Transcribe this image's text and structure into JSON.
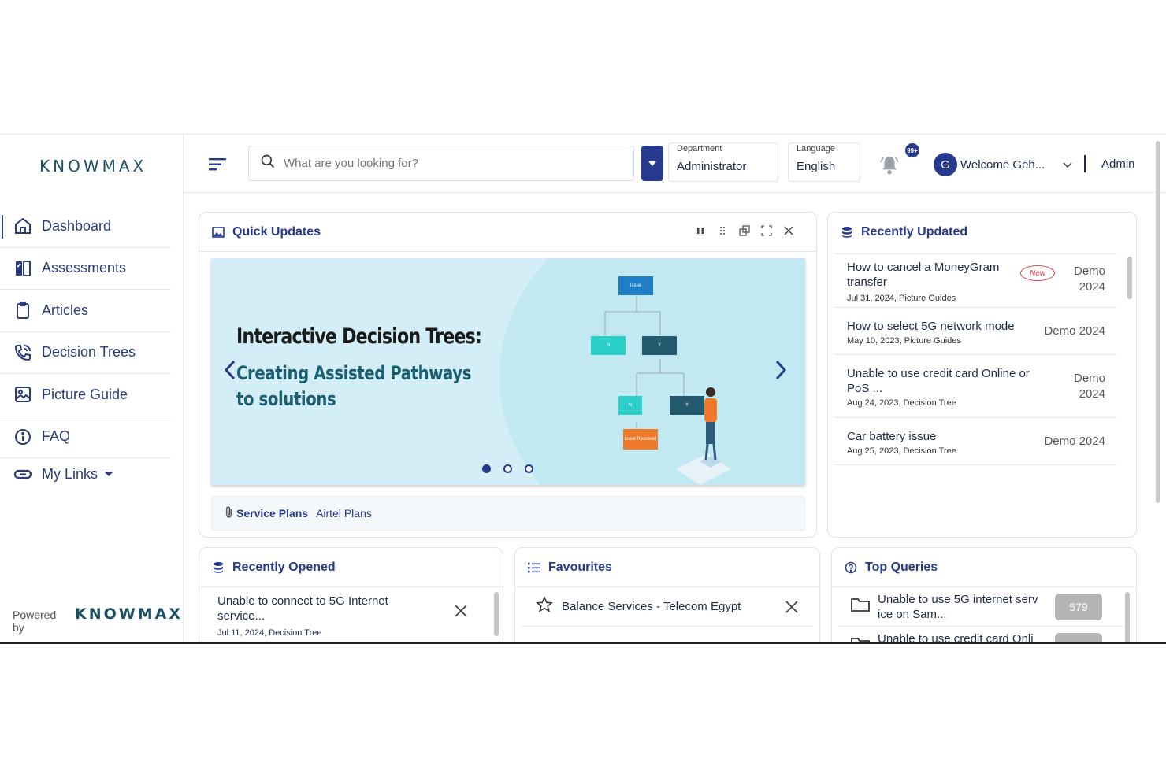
{
  "brand": {
    "logo": "KNOWMAX",
    "powered_by": "Powered by",
    "powered_logo": "KNOWMAX"
  },
  "sidebar": {
    "items": [
      {
        "label": "Dashboard",
        "icon": "home-icon",
        "active": true
      },
      {
        "label": "Assessments",
        "icon": "assessment-icon"
      },
      {
        "label": "Articles",
        "icon": "clipboard-icon"
      },
      {
        "label": "Decision Trees",
        "icon": "phone-icon"
      },
      {
        "label": "Picture Guide",
        "icon": "image-icon"
      },
      {
        "label": "FAQ",
        "icon": "info-icon"
      },
      {
        "label": "My Links",
        "icon": "link-icon"
      }
    ]
  },
  "header": {
    "search_placeholder": "What are you looking for?",
    "department": {
      "label": "Department",
      "value": "Administrator"
    },
    "language": {
      "label": "Language",
      "value": "English"
    },
    "notif_badge": "99+",
    "avatar_initial": "G",
    "welcome": "Welcome  Geh...",
    "role": "Admin"
  },
  "quick_updates": {
    "title": "Quick Updates",
    "banner_heading": "Interactive Decision Trees:",
    "banner_subheading": "Creating Assisted Pathways to solutions",
    "tree_labels": [
      "Issue",
      "N",
      "Y",
      "N",
      "Y",
      "Issue Resolved"
    ],
    "links_label": "Service Plans",
    "links_value": "Airtel Plans"
  },
  "recently_updated": {
    "title": "Recently Updated",
    "new_badge": "New",
    "items": [
      {
        "title": "How to cancel a MoneyGram transfer",
        "meta": "Jul 31, 2024, Picture Guides",
        "right1": "Demo",
        "right2": "2024"
      },
      {
        "title": "How to select 5G network mode",
        "meta": "May 10, 2023, Picture Guides",
        "right1": "Demo 2024",
        "right2": ""
      },
      {
        "title": "Unable to use credit card Online or PoS ...",
        "meta": "Aug 24, 2023, Decision Tree",
        "right1": "Demo",
        "right2": "2024"
      },
      {
        "title": "Car battery issue",
        "meta": "Aug 25, 2023, Decision Tree",
        "right1": "Demo 2024",
        "right2": ""
      }
    ]
  },
  "recently_opened": {
    "title": "Recently Opened",
    "items": [
      {
        "title": "Unable to connect to 5G Internet service...",
        "meta": "Jul 11, 2024, Decision Tree"
      }
    ]
  },
  "favourites": {
    "title": "Favourites",
    "items": [
      {
        "title": "Balance Services - Telecom Egypt"
      }
    ]
  },
  "top_queries": {
    "title": "Top Queries",
    "items": [
      {
        "title": "Unable to use 5G internet serv ice on Sam...",
        "count": "579"
      },
      {
        "title": "Unable to use credit card Onli",
        "count": ""
      }
    ]
  },
  "colors": {
    "accent": "#263a8e",
    "brand": "#1b4f63",
    "new_badge": "#e03a4a"
  }
}
